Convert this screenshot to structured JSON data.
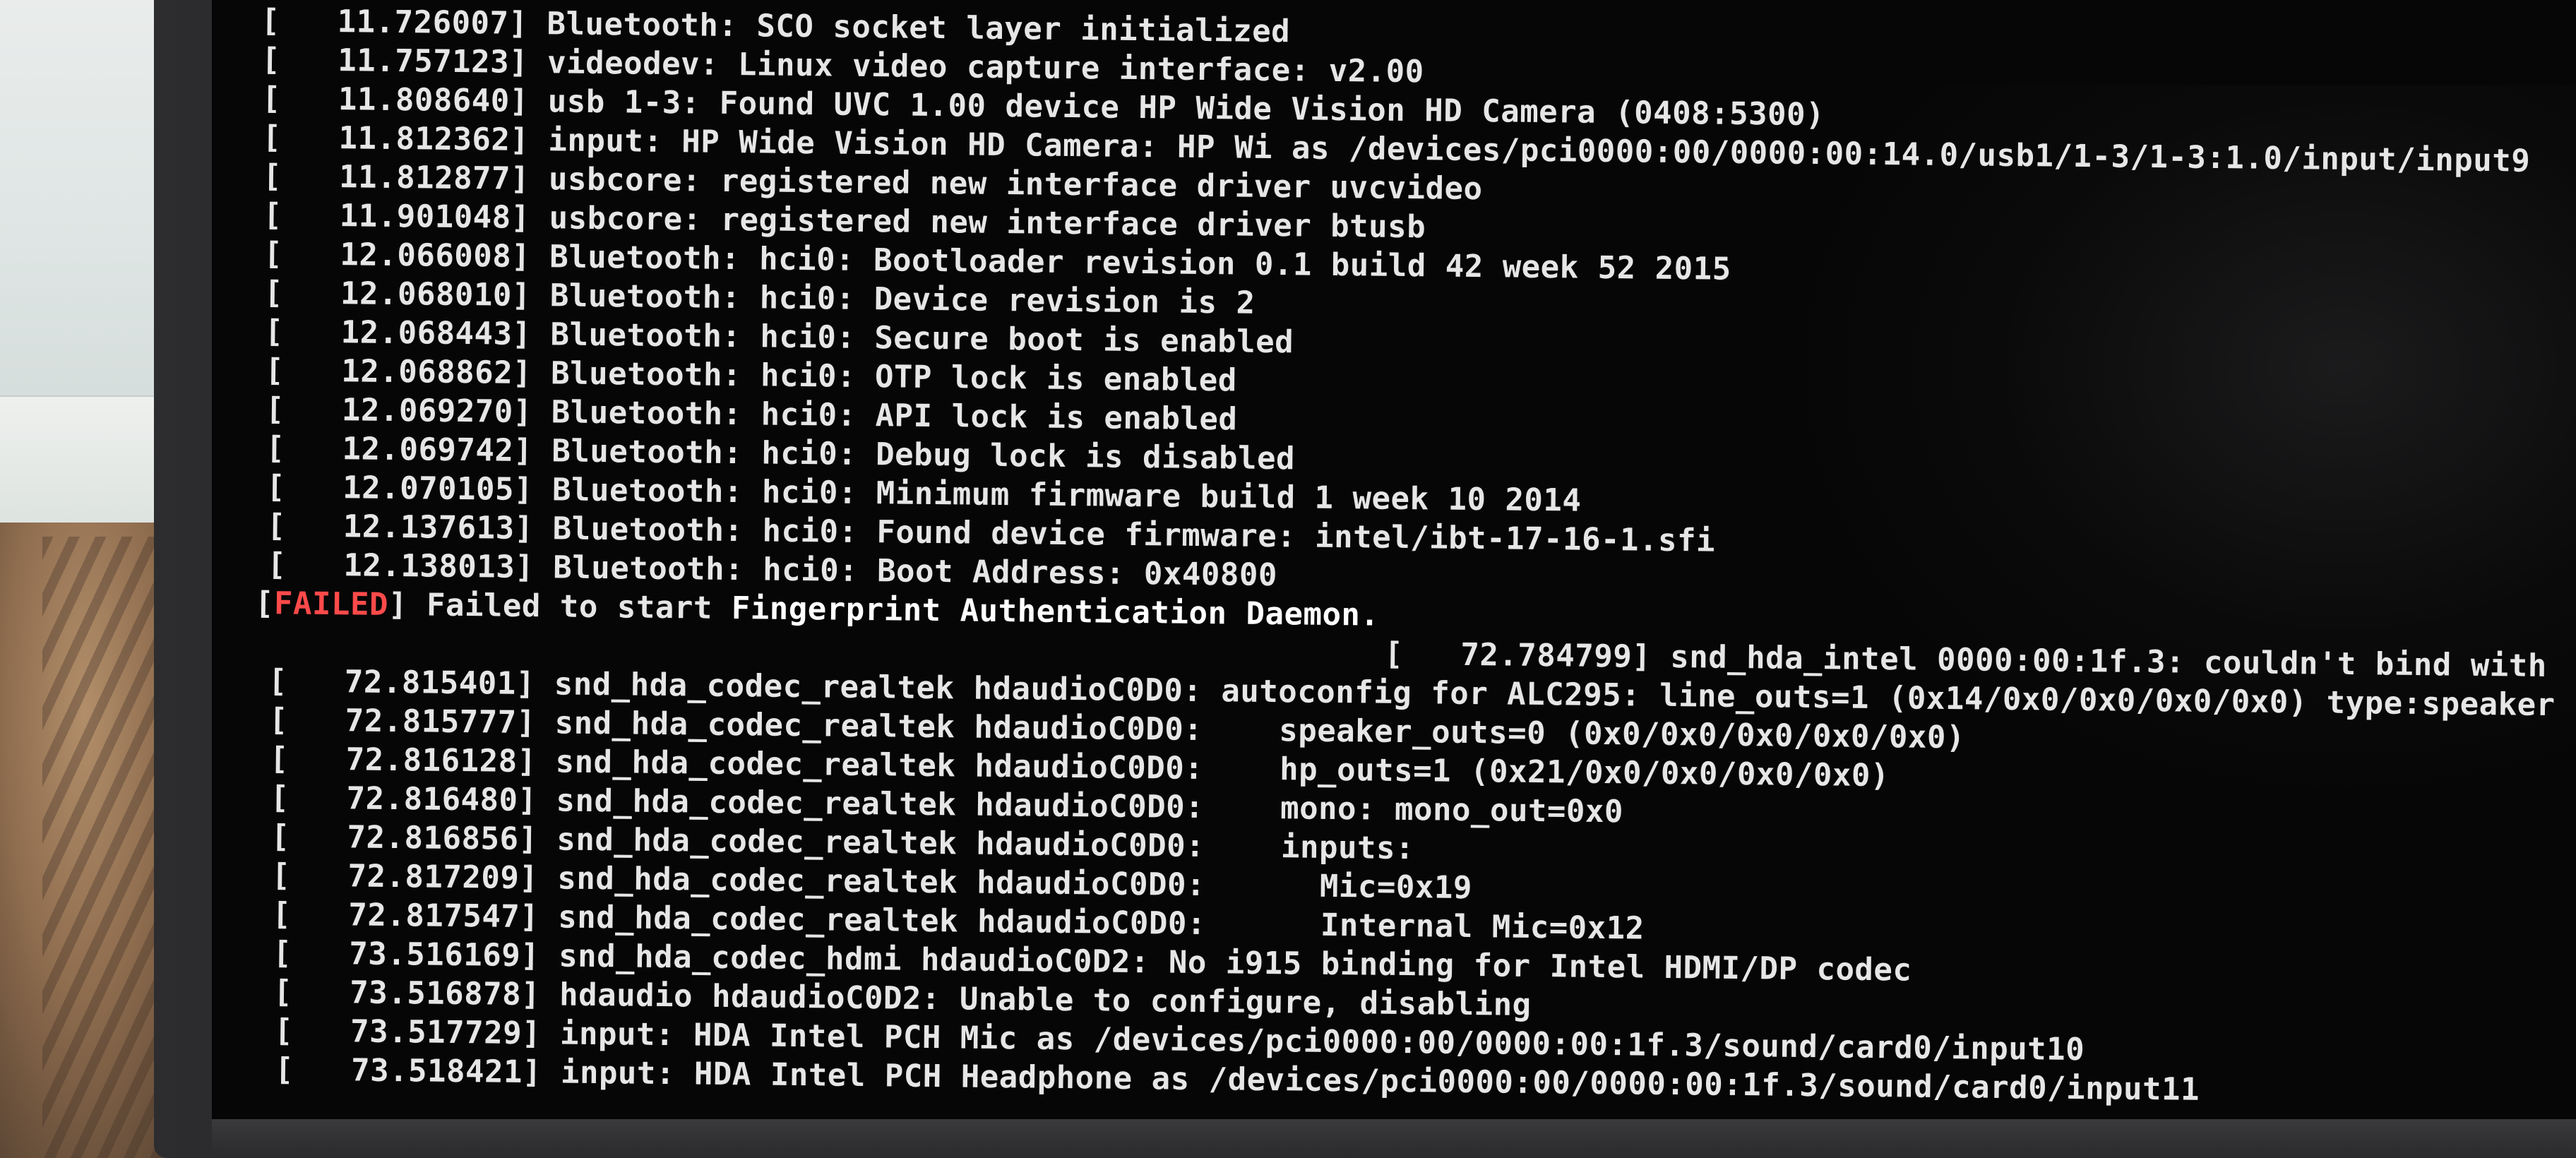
{
  "console": {
    "lines": [
      {
        "ts": "[   11.726007] ",
        "msg": "Bluetooth: SCO socket layer initialized"
      },
      {
        "ts": "[   11.757123] ",
        "msg": "videodev: Linux video capture interface: v2.00"
      },
      {
        "ts": "[   11.808640] ",
        "msg": "usb 1-3: Found UVC 1.00 device HP Wide Vision HD Camera (0408:5300)"
      },
      {
        "ts": "[   11.812362] ",
        "msg": "input: HP Wide Vision HD Camera: HP Wi as /devices/pci0000:00/0000:00:14.0/usb1/1-3/1-3:1.0/input/input9"
      },
      {
        "ts": "[   11.812877] ",
        "msg": "usbcore: registered new interface driver uvcvideo"
      },
      {
        "ts": "[   11.901048] ",
        "msg": "usbcore: registered new interface driver btusb"
      },
      {
        "ts": "[   12.066008] ",
        "msg": "Bluetooth: hci0: Bootloader revision 0.1 build 42 week 52 2015"
      },
      {
        "ts": "[   12.068010] ",
        "msg": "Bluetooth: hci0: Device revision is 2"
      },
      {
        "ts": "[   12.068443] ",
        "msg": "Bluetooth: hci0: Secure boot is enabled"
      },
      {
        "ts": "[   12.068862] ",
        "msg": "Bluetooth: hci0: OTP lock is enabled"
      },
      {
        "ts": "[   12.069270] ",
        "msg": "Bluetooth: hci0: API lock is enabled"
      },
      {
        "ts": "[   12.069742] ",
        "msg": "Bluetooth: hci0: Debug lock is disabled"
      },
      {
        "ts": "[   12.070105] ",
        "msg": "Bluetooth: hci0: Minimum firmware build 1 week 10 2014"
      },
      {
        "ts": "[   12.137613] ",
        "msg": "Bluetooth: hci0: Found device firmware: intel/ibt-17-16-1.sfi"
      },
      {
        "ts": "[   12.138013] ",
        "msg": "Bluetooth: hci0: Boot Address: 0x40800"
      }
    ],
    "failed_line": {
      "open": "[",
      "tag": "FAILED",
      "close": "] ",
      "msg_prefix": "Failed to start ",
      "msg_bold": "Fingerprint Authentication Daemon."
    },
    "indented_line": {
      "ts": "[   72.784799] ",
      "msg": "snd_hda_intel 0000:00:1f.3: couldn't bind with"
    },
    "lines2": [
      {
        "ts": "[   72.815401] ",
        "msg": "snd_hda_codec_realtek hdaudioC0D0: autoconfig for ALC295: line_outs=1 (0x14/0x0/0x0/0x0/0x0) type:speaker"
      },
      {
        "ts": "[   72.815777] ",
        "msg": "snd_hda_codec_realtek hdaudioC0D0:    speaker_outs=0 (0x0/0x0/0x0/0x0/0x0)"
      },
      {
        "ts": "[   72.816128] ",
        "msg": "snd_hda_codec_realtek hdaudioC0D0:    hp_outs=1 (0x21/0x0/0x0/0x0/0x0)"
      },
      {
        "ts": "[   72.816480] ",
        "msg": "snd_hda_codec_realtek hdaudioC0D0:    mono: mono_out=0x0"
      },
      {
        "ts": "[   72.816856] ",
        "msg": "snd_hda_codec_realtek hdaudioC0D0:    inputs:"
      },
      {
        "ts": "[   72.817209] ",
        "msg": "snd_hda_codec_realtek hdaudioC0D0:      Mic=0x19"
      },
      {
        "ts": "[   72.817547] ",
        "msg": "snd_hda_codec_realtek hdaudioC0D0:      Internal Mic=0x12"
      },
      {
        "ts": "[   73.516169] ",
        "msg": "snd_hda_codec_hdmi hdaudioC0D2: No i915 binding for Intel HDMI/DP codec"
      },
      {
        "ts": "[   73.516878] ",
        "msg": "hdaudio hdaudioC0D2: Unable to configure, disabling"
      },
      {
        "ts": "[   73.517729] ",
        "msg": "input: HDA Intel PCH Mic as /devices/pci0000:00/0000:00:1f.3/sound/card0/input10"
      },
      {
        "ts": "[   73.518421] ",
        "msg": "input: HDA Intel PCH Headphone as /devices/pci0000:00/0000:00:1f.3/sound/card0/input11"
      }
    ],
    "colors": {
      "text": "#e6e6e6",
      "failed": "#ff4a4a",
      "background": "#060606"
    }
  }
}
